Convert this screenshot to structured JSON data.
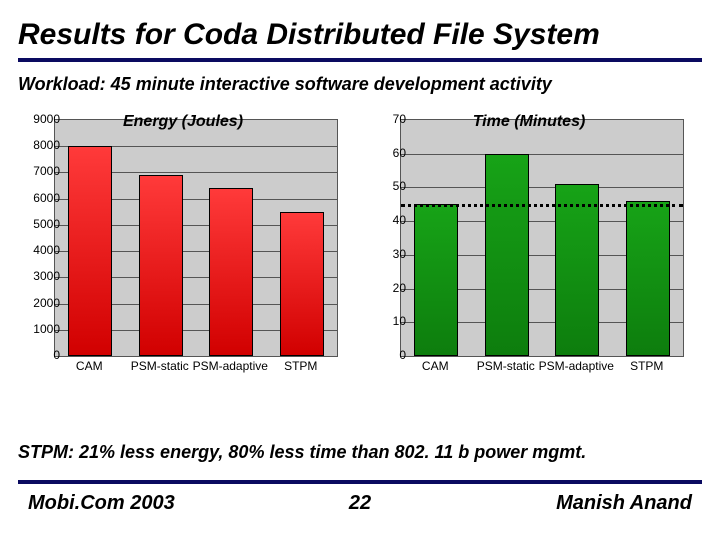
{
  "title": "Results for Coda Distributed File System",
  "subtitle": "Workload: 45 minute interactive software development activity",
  "conclusion": "STPM: 21% less energy, 80% less time than 802. 11 b power mgmt.",
  "footer": {
    "conference": "Mobi.Com 2003",
    "page": "22",
    "author": "Manish Anand"
  },
  "chart_data": [
    {
      "type": "bar",
      "title": "Energy (Joules)",
      "categories": [
        "CAM",
        "PSM-static",
        "PSM-adaptive",
        "STPM"
      ],
      "values": [
        8000,
        6900,
        6400,
        5500
      ],
      "ylim": [
        0,
        9000
      ],
      "ystep": 1000,
      "color": "red",
      "reference": null
    },
    {
      "type": "bar",
      "title": "Time (Minutes)",
      "categories": [
        "CAM",
        "PSM-static",
        "PSM-adaptive",
        "STPM"
      ],
      "values": [
        45,
        60,
        51,
        46
      ],
      "ylim": [
        0,
        70
      ],
      "ystep": 10,
      "color": "green",
      "reference": 45
    }
  ]
}
